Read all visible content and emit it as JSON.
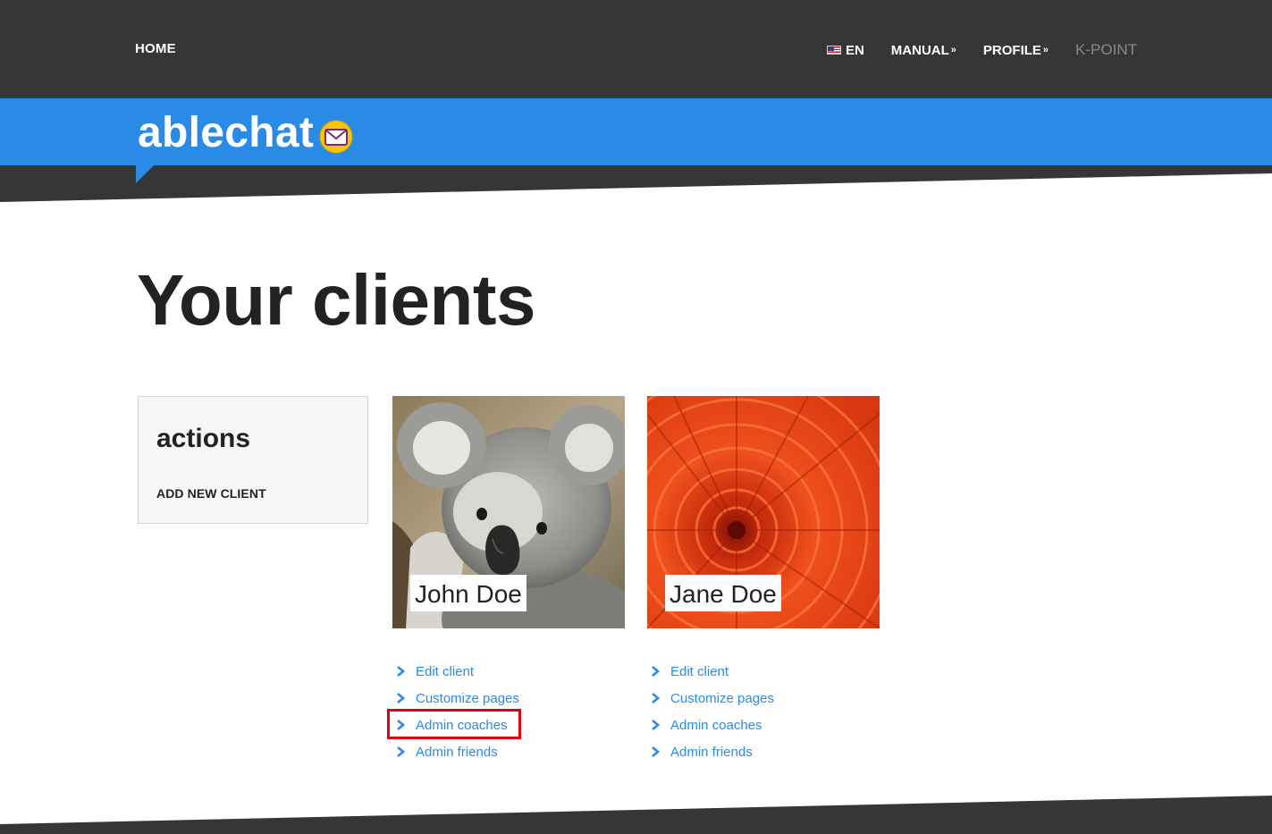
{
  "nav": {
    "home": "HOME",
    "language": "EN",
    "manual": "MANUAL",
    "profile": "PROFILE",
    "kpoint": "K-POINT"
  },
  "brand": {
    "name": "ablechat"
  },
  "page": {
    "title": "Your clients"
  },
  "actions": {
    "title": "actions",
    "add_client": "ADD NEW CLIENT"
  },
  "clients": [
    {
      "name": "John Doe",
      "image": "koala-photo",
      "links": [
        "Edit client",
        "Customize pages",
        "Admin coaches",
        "Admin friends"
      ],
      "highlighted_link": "Admin coaches"
    },
    {
      "name": "Jane Doe",
      "image": "orange-flower-photo",
      "links": [
        "Edit client",
        "Customize pages",
        "Admin coaches",
        "Admin friends"
      ]
    }
  ],
  "colors": {
    "nav_bg": "#363636",
    "brand_blue": "#2a8be6",
    "link_blue": "#2a8be6",
    "highlight_red": "#e0000f"
  },
  "icons": {
    "mail": "envelope-icon",
    "link_arrow": "chevron-right-icon",
    "dropdown": "double-chevron-down-icon",
    "language_flag": "us-flag-icon"
  }
}
